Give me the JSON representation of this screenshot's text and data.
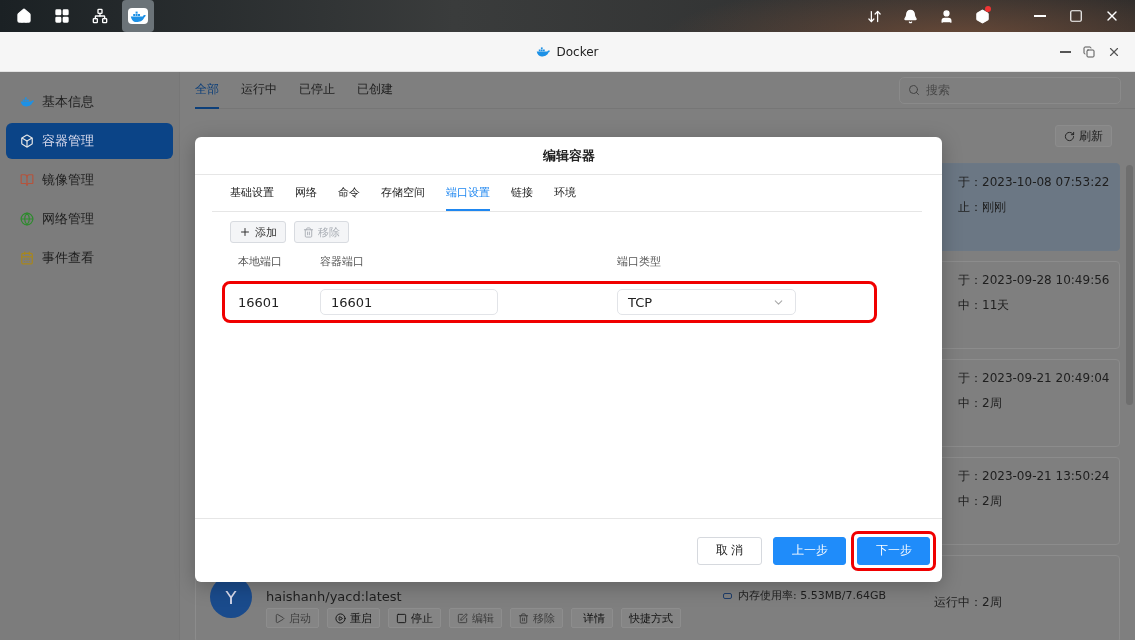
{
  "taskbar": {
    "apps": [
      {
        "kind": "home",
        "selected": false
      },
      {
        "kind": "apps",
        "selected": false
      },
      {
        "kind": "network",
        "selected": false
      },
      {
        "kind": "docker",
        "selected": true
      }
    ],
    "settings_badge": true
  },
  "window": {
    "title": "Docker"
  },
  "sidebar": {
    "items": [
      {
        "label": "基本信息",
        "kind": "info",
        "selected": false
      },
      {
        "label": "容器管理",
        "kind": "containers",
        "selected": true
      },
      {
        "label": "镜像管理",
        "kind": "images",
        "selected": false
      },
      {
        "label": "网络管理",
        "kind": "network",
        "selected": false
      },
      {
        "label": "事件查看",
        "kind": "events",
        "selected": false
      }
    ]
  },
  "filter_tabs": [
    {
      "label": "全部",
      "selected": true
    },
    {
      "label": "运行中",
      "selected": false
    },
    {
      "label": "已停止",
      "selected": false
    },
    {
      "label": "已创建",
      "selected": false
    }
  ],
  "search": {
    "placeholder": "搜索"
  },
  "refresh_button": "刷新",
  "containers": [
    {
      "highlighted": true,
      "created": "于：2023-10-08 07:53:22",
      "status": "止：刚刚"
    },
    {
      "highlighted": false,
      "created": "于：2023-09-28 10:49:56",
      "status": "中：11天"
    },
    {
      "highlighted": false,
      "created": "于：2023-09-21 20:49:04",
      "status": "中：2周"
    },
    {
      "highlighted": false,
      "created": "于：2023-09-21 13:50:24",
      "status": "中：2周"
    },
    {
      "highlighted": false,
      "avatar": "Y",
      "image": "haishanh/yacd:latest",
      "memory": "内存使用率: 5.53MB/7.64GB",
      "status": "运行中：2周",
      "actions": [
        {
          "label": "启动",
          "kind": "start",
          "disabled": true
        },
        {
          "label": "重启",
          "kind": "restart",
          "disabled": false
        },
        {
          "label": "停止",
          "kind": "stop",
          "disabled": false
        },
        {
          "label": "编辑",
          "kind": "edit",
          "disabled": true
        },
        {
          "label": "移除",
          "kind": "remove",
          "disabled": true
        },
        {
          "label": "详情",
          "kind": "details",
          "disabled": false
        },
        {
          "label": "快捷方式",
          "kind": "shortcut",
          "disabled": false
        }
      ]
    }
  ],
  "dialog": {
    "title": "编辑容器",
    "tabs": [
      {
        "label": "基础设置",
        "selected": false
      },
      {
        "label": "网络",
        "selected": false
      },
      {
        "label": "命令",
        "selected": false
      },
      {
        "label": "存储空间",
        "selected": false
      },
      {
        "label": "端口设置",
        "selected": true
      },
      {
        "label": "链接",
        "selected": false
      },
      {
        "label": "环境",
        "selected": false
      }
    ],
    "add_button": {
      "label": "添加",
      "disabled": false
    },
    "remove_button": {
      "label": "移除",
      "disabled": true
    },
    "columns": [
      "本地端口",
      "容器端口",
      "端口类型"
    ],
    "ports": [
      {
        "local": "16601",
        "container": "16601",
        "type": "TCP",
        "highlighted": true
      }
    ],
    "buttons": [
      {
        "label": "取 消",
        "kind": "default",
        "highlighted": false
      },
      {
        "label": "上一步",
        "kind": "primary",
        "highlighted": false
      },
      {
        "label": "下一步",
        "kind": "primary",
        "highlighted": true
      }
    ]
  }
}
